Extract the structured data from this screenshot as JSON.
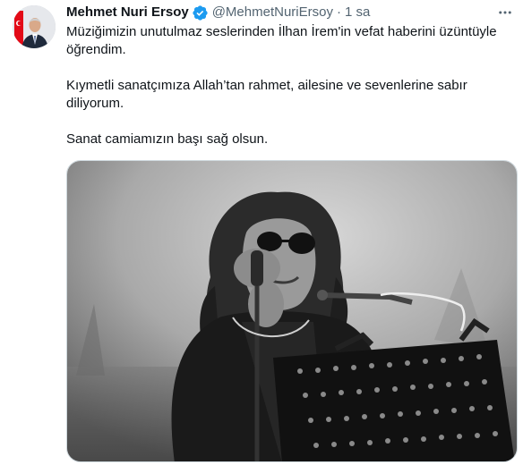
{
  "tweet": {
    "author_name": "Mehmet Nuri Ersoy",
    "handle": "@MehmetNuriErsoy",
    "separator": "·",
    "time": "1 sa",
    "verified": true,
    "lines": [
      "Müziğimizin unutulmaz seslerinden İlhan İrem'in vefat haberini üzüntüyle",
      "öğrendim.",
      "",
      "Kıymetli sanatçımıza Allah’tan rahmet, ailesine ve sevenlerine sabır",
      "diliyorum.",
      "",
      "Sanat camiamızın başı sağ olsun."
    ],
    "icons": {
      "verified": "verified-badge-icon",
      "more": "more-options-icon"
    },
    "colors": {
      "verified_badge": "#1d9bf0",
      "secondary_text": "#536471",
      "primary_text": "#0f1419",
      "flag_red": "#e30a17"
    }
  }
}
